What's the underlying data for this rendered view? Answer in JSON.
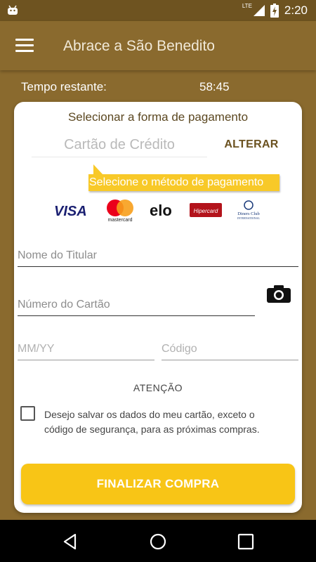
{
  "status_bar": {
    "time": "2:20",
    "network_label": "LTE",
    "battery_level": "charging"
  },
  "app_bar": {
    "title": "Abrace a São Benedito",
    "menu_icon": "hamburger-menu-icon"
  },
  "timer": {
    "label": "Tempo restante:",
    "value": "58:45"
  },
  "payment": {
    "title": "Selecionar a forma de pagamento",
    "method_value": "Cartão de Crédito",
    "change_button": "ALTERAR",
    "tooltip": "Selecione o método de pagamento",
    "brands": [
      "VISA",
      "mastercard",
      "elo",
      "Hipercard",
      "Diners Club INTERNATIONAL"
    ]
  },
  "form": {
    "holder_name_placeholder": "Nome do Titular",
    "card_number_placeholder": "Número do Cartão",
    "expiry_placeholder": "MM/YY",
    "code_placeholder": "Código",
    "camera_icon": "camera-icon"
  },
  "notice": {
    "heading": "ATENÇÃO",
    "save_card_text": "Desejo salvar os dados do meu cartão, exceto o código de segurança, para as próximas compras.",
    "save_card_checked": false
  },
  "actions": {
    "finish_button": "FINALIZAR COMPRA"
  },
  "colors": {
    "brand_brown": "#8a6a2e",
    "accent_yellow": "#f8c516",
    "mastercard_red": "#eb001b",
    "mastercard_orange": "#f79e1b",
    "hipercard_red": "#b3131b",
    "visa_blue": "#1a1f71"
  }
}
